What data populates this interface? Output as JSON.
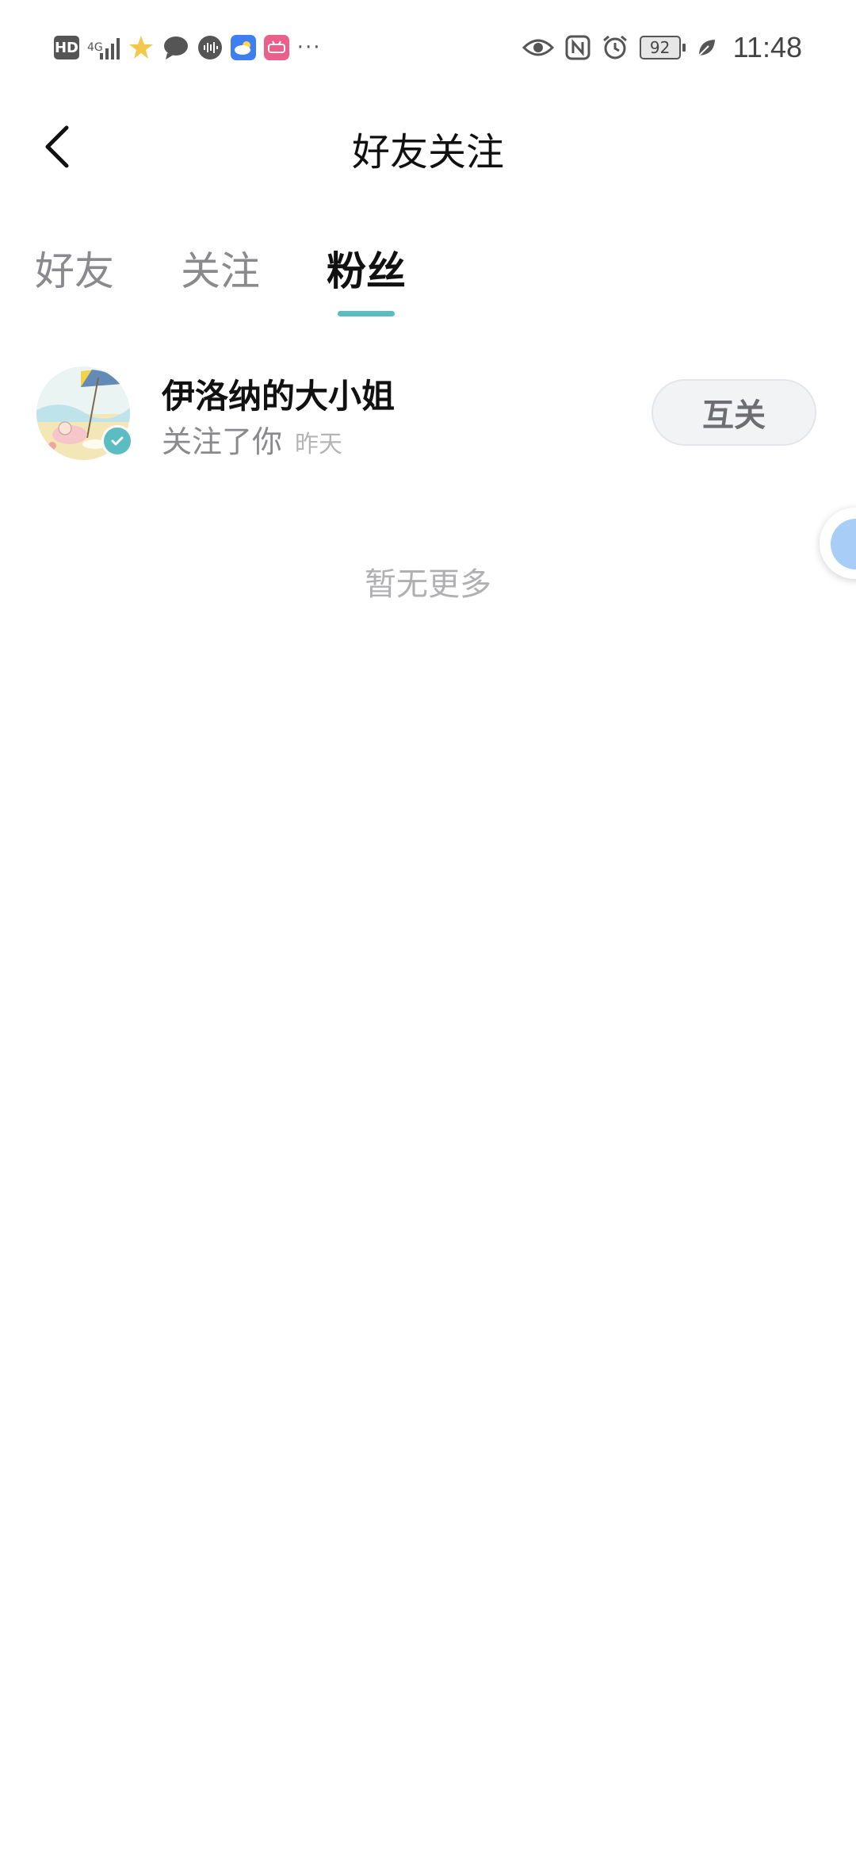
{
  "status_bar": {
    "left_icons": [
      "hd-icon",
      "signal-4g-icon",
      "star-app-icon",
      "message-icon",
      "audio-icon",
      "weather-app-icon",
      "pink-app-icon",
      "more-dots-icon"
    ],
    "hd_label": "HD",
    "network_label": "4G",
    "battery": "92",
    "time": "11:48",
    "right_icons": [
      "eye-icon",
      "nfc-icon",
      "alarm-icon",
      "battery-icon",
      "leaf-icon"
    ]
  },
  "header": {
    "title": "好友关注"
  },
  "tabs": [
    {
      "label": "好友",
      "active": false
    },
    {
      "label": "关注",
      "active": false
    },
    {
      "label": "粉丝",
      "active": true
    }
  ],
  "list": {
    "items": [
      {
        "name": "伊洛纳的大小姐",
        "subtitle": "关注了你",
        "time": "昨天",
        "action_label": "互关",
        "verified": true
      }
    ],
    "end_text": "暂无更多"
  },
  "colors": {
    "accent": "#5bbcc1",
    "button_bg": "#f2f3f5",
    "muted_text": "#8a8a8e"
  }
}
